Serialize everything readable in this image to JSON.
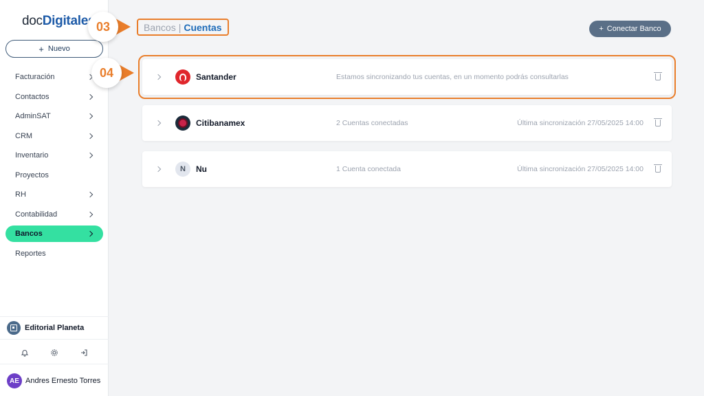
{
  "sidebar": {
    "logo_prefix": "doc",
    "logo_bold": "Digitales",
    "new_button": "Nuevo",
    "items": [
      {
        "label": "Facturación"
      },
      {
        "label": "Contactos"
      },
      {
        "label": "AdminSAT"
      },
      {
        "label": "CRM"
      },
      {
        "label": "Inventario"
      },
      {
        "label": "Proyectos"
      },
      {
        "label": "RH"
      },
      {
        "label": "Contabilidad"
      },
      {
        "label": "Bancos"
      },
      {
        "label": "Reportes"
      }
    ],
    "company": "Editorial Planeta",
    "user_initials": "AE",
    "user_name": "Andres Ernesto Torres"
  },
  "breadcrumb": {
    "banks": "Bancos",
    "separator": "|",
    "accounts": "Cuentas"
  },
  "steps": {
    "step3": "03",
    "step4": "04"
  },
  "header": {
    "connect_button": "Conectar Banco"
  },
  "banks": [
    {
      "name": "Santander",
      "status": "Estamos sincronizando tus cuentas, en un momento podrás consultarlas",
      "sync": ""
    },
    {
      "name": "Citibanamex",
      "status": "2 Cuentas conectadas",
      "sync": "Última sincronización 27/05/2025 14:00"
    },
    {
      "name": "Nu",
      "logo_letter": "N",
      "status": "1 Cuenta conectada",
      "sync": "Última sincronización 27/05/2025 14:00"
    }
  ],
  "colors": {
    "accent_orange": "#e97d2a",
    "active_nav": "#34e0a1",
    "brand_blue": "#1e5ba8",
    "connect_button": "#5a6f87"
  }
}
